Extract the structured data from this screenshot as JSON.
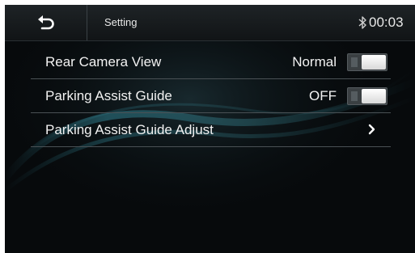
{
  "header": {
    "title": "Setting",
    "back_icon": "back-arrow-icon",
    "bluetooth_icon": "bluetooth-icon",
    "clock": "00:03"
  },
  "settings": {
    "rear_camera_view": {
      "label": "Rear Camera View",
      "value": "Normal"
    },
    "parking_assist_guide": {
      "label": "Parking Assist Guide",
      "value": "OFF"
    },
    "parking_assist_guide_adjust": {
      "label": "Parking Assist Guide Adjust",
      "icon": "chevron-right-icon"
    }
  },
  "colors": {
    "background": "#070a0c",
    "accent_wave": "#2f7f8f",
    "text": "#f2f2f2",
    "divider": "#4a5155"
  }
}
